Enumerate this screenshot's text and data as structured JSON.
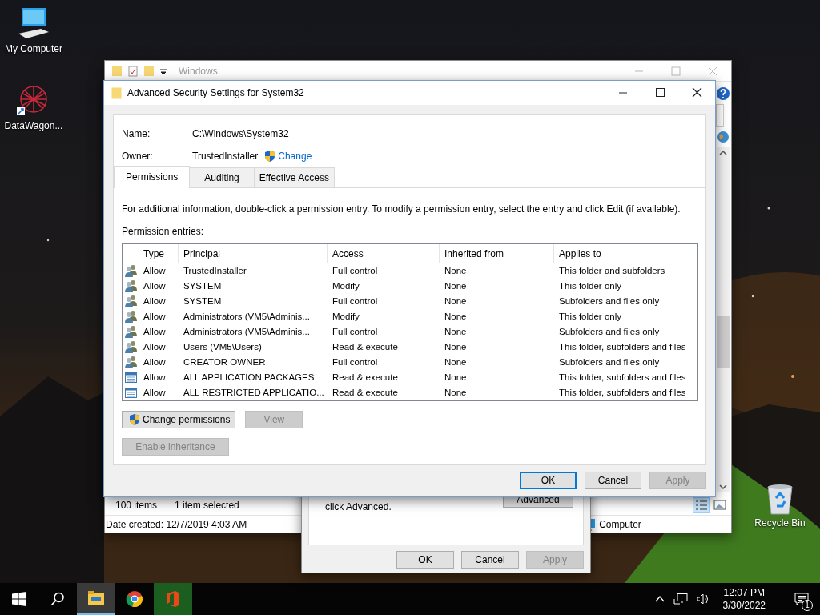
{
  "desktop_icons": [
    {
      "kind": "computer",
      "label": "My Computer"
    },
    {
      "kind": "app",
      "label": "DataWagon..."
    },
    {
      "kind": "recycle",
      "label": "Recycle Bin"
    }
  ],
  "explorer": {
    "title": "Windows",
    "item_count": "100 items",
    "selection": "1 item selected",
    "details": "Date created: 12/7/2019 4:03 AM",
    "location": "Computer"
  },
  "properties_dialog": {
    "note": "click Advanced.",
    "advanced_button": "Advanced",
    "buttons": [
      {
        "label": "OK",
        "disabled": false
      },
      {
        "label": "Cancel",
        "disabled": false
      },
      {
        "label": "Apply",
        "disabled": true
      }
    ]
  },
  "advanced_dialog": {
    "title": "Advanced Security Settings for System32",
    "name_label": "Name:",
    "name_value": "C:\\Windows\\System32",
    "owner_label": "Owner:",
    "owner_value": "TrustedInstaller",
    "change_link": "Change",
    "tabs": [
      {
        "label": "Permissions",
        "selected": true
      },
      {
        "label": "Auditing",
        "selected": false
      },
      {
        "label": "Effective Access",
        "selected": false
      }
    ],
    "info": "For additional information, double-click a permission entry. To modify a permission entry, select the entry and click Edit (if available).",
    "entries_label": "Permission entries:",
    "columns": [
      "Type",
      "Principal",
      "Access",
      "Inherited from",
      "Applies to"
    ],
    "rows": [
      {
        "kind": "user",
        "type": "Allow",
        "principal": "TrustedInstaller",
        "access": "Full control",
        "inherited_from": "None",
        "applies_to": "This folder and subfolders"
      },
      {
        "kind": "user",
        "type": "Allow",
        "principal": "SYSTEM",
        "access": "Modify",
        "inherited_from": "None",
        "applies_to": "This folder only"
      },
      {
        "kind": "user",
        "type": "Allow",
        "principal": "SYSTEM",
        "access": "Full control",
        "inherited_from": "None",
        "applies_to": "Subfolders and files only"
      },
      {
        "kind": "user",
        "type": "Allow",
        "principal": "Administrators (VM5\\Adminis...",
        "access": "Modify",
        "inherited_from": "None",
        "applies_to": "This folder only"
      },
      {
        "kind": "user",
        "type": "Allow",
        "principal": "Administrators (VM5\\Adminis...",
        "access": "Full control",
        "inherited_from": "None",
        "applies_to": "Subfolders and files only"
      },
      {
        "kind": "user",
        "type": "Allow",
        "principal": "Users (VM5\\Users)",
        "access": "Read & execute",
        "inherited_from": "None",
        "applies_to": "This folder, subfolders and files"
      },
      {
        "kind": "user",
        "type": "Allow",
        "principal": "CREATOR OWNER",
        "access": "Full control",
        "inherited_from": "None",
        "applies_to": "Subfolders and files only"
      },
      {
        "kind": "package",
        "type": "Allow",
        "principal": "ALL APPLICATION PACKAGES",
        "access": "Read & execute",
        "inherited_from": "None",
        "applies_to": "This folder, subfolders and files"
      },
      {
        "kind": "package",
        "type": "Allow",
        "principal": "ALL RESTRICTED APPLICATIO...",
        "access": "Read & execute",
        "inherited_from": "None",
        "applies_to": "This folder, subfolders and files"
      }
    ],
    "entry_buttons": [
      {
        "label": "Change permissions",
        "shield": true,
        "disabled": false
      },
      {
        "label": "View",
        "disabled": true
      }
    ],
    "inheritance_button": {
      "label": "Enable inheritance",
      "disabled": true
    },
    "footer_buttons": [
      {
        "label": "OK",
        "disabled": false,
        "default": true
      },
      {
        "label": "Cancel",
        "disabled": false
      },
      {
        "label": "Apply",
        "disabled": true
      }
    ]
  },
  "taskbar": {
    "apps": [
      {
        "kind": "explorer",
        "selected": true
      },
      {
        "kind": "chrome",
        "selected": false
      },
      {
        "kind": "office",
        "selected": false
      }
    ],
    "time": "12:07 PM",
    "date": "3/30/2022",
    "notification_count": "1"
  }
}
